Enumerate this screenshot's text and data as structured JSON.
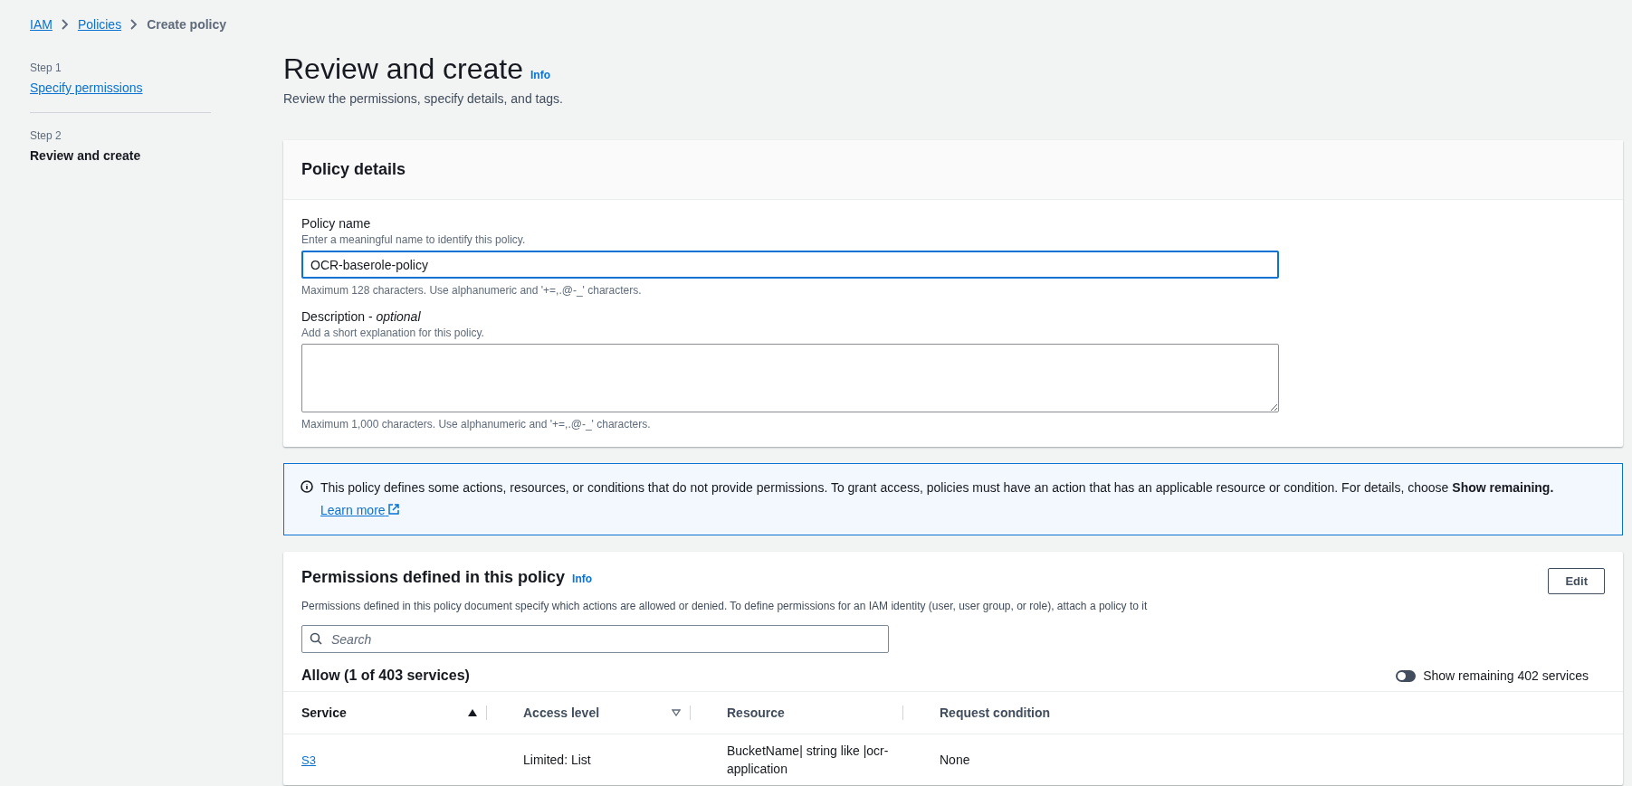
{
  "breadcrumbs": [
    {
      "label": "IAM",
      "link": true
    },
    {
      "label": "Policies",
      "link": true
    },
    {
      "label": "Create policy",
      "link": false
    }
  ],
  "steps": [
    {
      "step": "Step 1",
      "label": "Specify permissions",
      "selected": false
    },
    {
      "step": "Step 2",
      "label": "Review and create",
      "selected": true
    }
  ],
  "page": {
    "title": "Review and create",
    "info": "Info",
    "subtitle": "Review the permissions, specify details, and tags."
  },
  "policy_details": {
    "title": "Policy details",
    "name_field": {
      "label": "Policy name",
      "description": "Enter a meaningful name to identify this policy.",
      "value": "OCR-baserole-policy",
      "focused": true,
      "constraint": "Maximum 128 characters. Use alphanumeric and '+=,.@-_' characters."
    },
    "description_field": {
      "label": "Description - *optional*",
      "description": "Add a short explanation for this policy.",
      "constraint": "Maximum 1,000 characters. Use alphanumeric and '+=,.@-_' characters."
    }
  },
  "alert": {
    "text": "This policy defines some actions, resources, or conditions that do not provide permissions. To grant access, policies must have an action that has an applicable resource or condition. For details, choose **Show remaining.**",
    "link": "Learn more"
  },
  "permissions": {
    "title": "Permissions defined in this policy",
    "info": "Info",
    "edit": "Edit",
    "description": "Permissions defined in this policy document specify which actions are allowed or denied. To define permissions for an IAM identity (user, user group, or role), attach a policy to it",
    "search": {
      "placeholder": "Search"
    },
    "allow_title": "Allow (1 of 403 services)",
    "toggle": {
      "label": "Show remaining 402 services",
      "on": false
    },
    "table": {
      "columns": [
        {
          "label": "Service",
          "sortable": true,
          "sorted": true
        },
        {
          "label": "Access level",
          "sortable": true,
          "sorted": false
        },
        {
          "label": "Resource",
          "sortable": false,
          "sorted": false
        },
        {
          "label": "Request condition",
          "sortable": false,
          "sorted": false
        }
      ],
      "rows": [
        {
          "service": "S3",
          "access_level": "Limited: List",
          "resource": "BucketName| string like |ocr-application",
          "request_condition": "None"
        }
      ]
    }
  }
}
